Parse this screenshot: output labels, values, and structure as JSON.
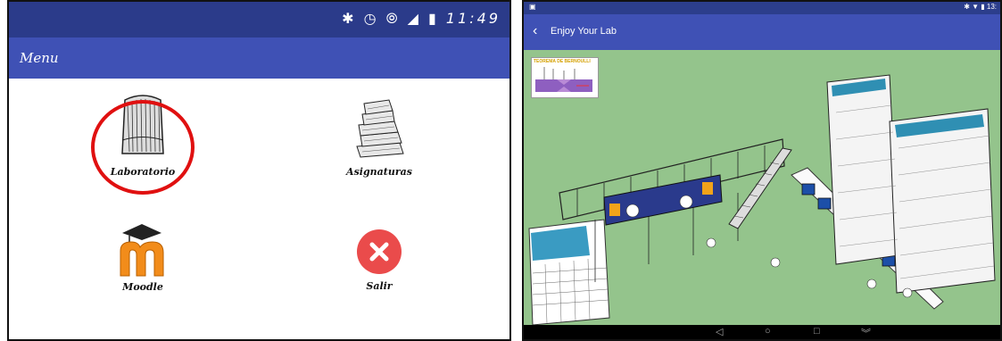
{
  "left_screen": {
    "status_icons": "✱ ◷ ⦾ ◢ ▮",
    "time": "11:49",
    "appbar_title": "Menu",
    "items": [
      {
        "label": "Laboratorio",
        "icon": "lab-book-icon"
      },
      {
        "label": "Asignaturas",
        "icon": "stacked-books-icon"
      },
      {
        "label": "Moodle",
        "icon": "moodle-icon"
      },
      {
        "label": "Salir",
        "icon": "exit-icon"
      }
    ]
  },
  "right_screen": {
    "title": "Enjoy Your Lab",
    "thumbnail_text": "TEOREMA DE BERNOULLI",
    "status_right": "✱ ▼ ▮ 13:",
    "nav": [
      "◁",
      "○",
      "□",
      "︾"
    ]
  },
  "colors": {
    "accent": "#3f51b5",
    "status": "#2b3b8a",
    "highlight": "#e01010",
    "exit": "#ea4b4b",
    "moodle_orange": "#f28c1a"
  }
}
